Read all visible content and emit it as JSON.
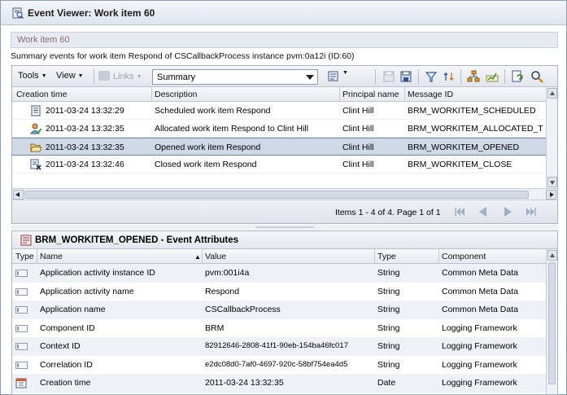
{
  "window": {
    "title": "Event Viewer: Work item 60",
    "work_item_label": "Work item 60",
    "summary_line": "Summary events for work item Respond of CSCallbackProcess instance pvm:0a12i (ID:60)"
  },
  "toolbar": {
    "tools_label": "Tools",
    "view_label": "View",
    "links_label": "Links",
    "filter_selected": "Summary"
  },
  "events_grid": {
    "columns": [
      "Creation time",
      "Description",
      "Principal name",
      "Message ID"
    ],
    "rows": [
      {
        "time": "2011-03-24 13:32:29",
        "description": "Scheduled work item Respond",
        "principal": "Clint Hill",
        "message_id": "BRM_WORKITEM_SCHEDULED",
        "icon": "scheduled-document-icon",
        "selected": false
      },
      {
        "time": "2011-03-24 13:32:35",
        "description": "Allocated work item Respond to Clint Hill",
        "principal": "Clint Hill",
        "message_id": "BRM_WORKITEM_ALLOCATED_T",
        "icon": "allocated-user-icon",
        "selected": false
      },
      {
        "time": "2011-03-24 13:32:35",
        "description": "Opened work item Respond",
        "principal": "Clint Hill",
        "message_id": "BRM_WORKITEM_OPENED",
        "icon": "opened-folder-icon",
        "selected": true
      },
      {
        "time": "2011-03-24 13:32:46",
        "description": "Closed work item Respond",
        "principal": "Clint Hill",
        "message_id": "BRM_WORKITEM_CLOSE",
        "icon": "closed-document-icon",
        "selected": false
      }
    ]
  },
  "pager": {
    "text": "Items 1 - 4 of 4. Page 1 of 1"
  },
  "attributes": {
    "title": "BRM_WORKITEM_OPENED - Event Attributes",
    "columns": [
      "Type",
      "Name",
      "Value",
      "Type",
      "Component"
    ],
    "sort_indicator": "▲",
    "rows": [
      {
        "name": "Application activity instance ID",
        "value": "pvm:001i4a",
        "type": "String",
        "component": "Common Meta Data",
        "icon": "string-field-icon"
      },
      {
        "name": "Application activity name",
        "value": "Respond",
        "type": "String",
        "component": "Common Meta Data",
        "icon": "string-field-icon"
      },
      {
        "name": "Application name",
        "value": "CSCallbackProcess",
        "type": "String",
        "component": "Common Meta Data",
        "icon": "string-field-icon"
      },
      {
        "name": "Component ID",
        "value": "BRM",
        "type": "String",
        "component": "Logging Framework",
        "icon": "string-field-icon"
      },
      {
        "name": "Context ID",
        "value": "82912646-2808-41f1-90eb-154ba46fc017",
        "type": "String",
        "component": "Logging Framework",
        "icon": "string-field-icon"
      },
      {
        "name": "Correlation ID",
        "value": "e2dc08d0-7af0-4697-920c-58bf754ea4d5",
        "type": "String",
        "component": "Logging Framework",
        "icon": "string-field-icon"
      },
      {
        "name": "Creation time",
        "value": "2011-03-24 13:32:35",
        "type": "Date",
        "component": "Logging Framework",
        "icon": "date-field-icon"
      }
    ]
  },
  "colors": {
    "selection": "#cfd8e6",
    "work_item_text": "#8a6d6d",
    "alt_row": "#eef1f6"
  }
}
